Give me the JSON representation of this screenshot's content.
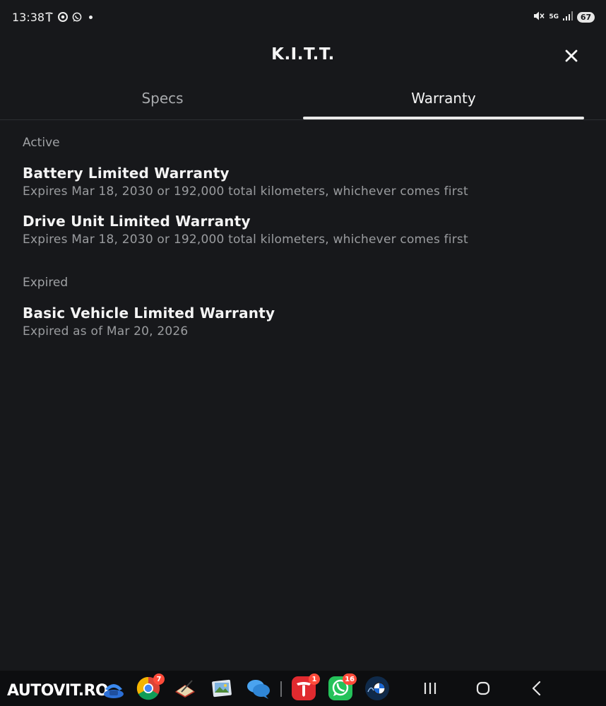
{
  "status_bar": {
    "time": "13:38",
    "left_icons": [
      "tesla-notification-icon",
      "chrome-notification-icon",
      "whatsapp-notification-icon"
    ],
    "network": "5G",
    "battery": "67"
  },
  "header": {
    "title": "K.I.T.T."
  },
  "tabs": [
    {
      "label": "Specs",
      "selected": false
    },
    {
      "label": "Warranty",
      "selected": true
    }
  ],
  "sections": [
    {
      "label": "Active",
      "items": [
        {
          "title": "Battery Limited Warranty",
          "subtitle": "Expires Mar 18, 2030 or 192,000 total kilometers, whichever comes first"
        },
        {
          "title": "Drive Unit Limited Warranty",
          "subtitle": "Expires Mar 18, 2030 or 192,000 total kilometers, whichever comes first"
        }
      ]
    },
    {
      "label": "Expired",
      "items": [
        {
          "title": "Basic Vehicle Limited Warranty",
          "subtitle": "Expired as of Mar 20, 2026"
        }
      ]
    }
  ],
  "taskbar": {
    "brand": "AUTOVIT.RO",
    "apps": [
      {
        "name": "phone-app-icon"
      },
      {
        "name": "chrome-app-icon",
        "badge": "7"
      },
      {
        "name": "notes-app-icon"
      },
      {
        "name": "gallery-app-icon"
      },
      {
        "name": "messages-app-icon"
      },
      {
        "name": "tesla-app-icon",
        "badge": "1"
      },
      {
        "name": "whatsapp-app-icon",
        "badge": "16"
      },
      {
        "name": "bmw-app-icon"
      }
    ],
    "nav": [
      "recents-button",
      "home-button",
      "back-button"
    ]
  },
  "colors": {
    "background": "#17181b",
    "text_primary": "#f4f4f4",
    "text_secondary": "#9a9c9f",
    "tab_indicator": "#e9e9e9",
    "badge": "#ff4b3a"
  }
}
